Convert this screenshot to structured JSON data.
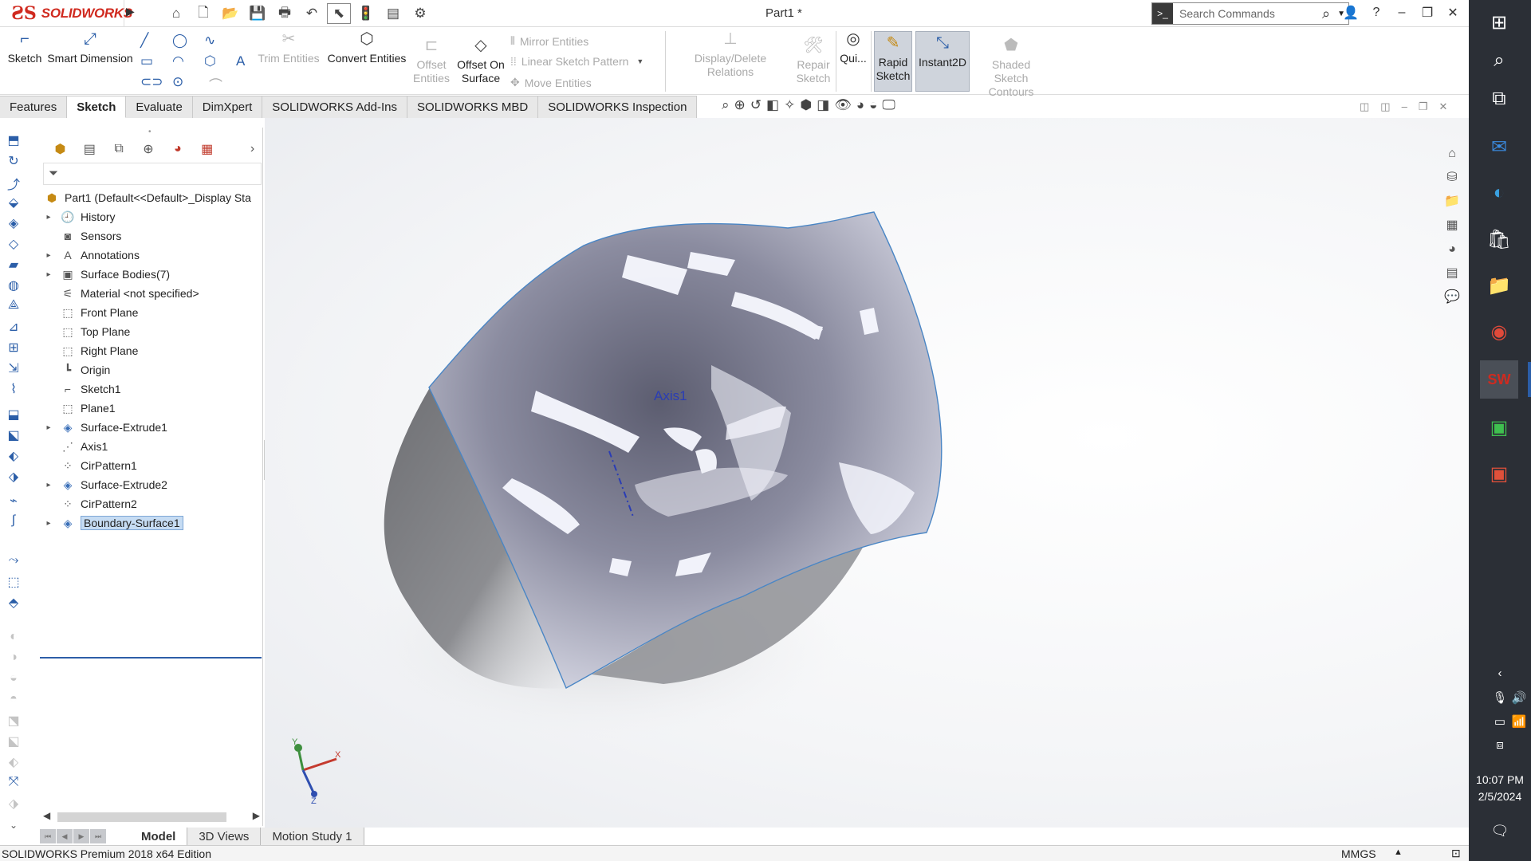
{
  "app": {
    "logo_text": "SOLIDWORKS",
    "doc_title": "Part1 *",
    "search_placeholder": "Search Commands"
  },
  "command_manager": {
    "sketch": "Sketch",
    "smart_dimension_line1": "Smart Dimension",
    "trim_entities": "Trim Entities",
    "convert_entities": "Convert Entities",
    "offset_entities_line1": "Offset",
    "offset_entities_line2": "Entities",
    "offset_on_surface_line1": "Offset On",
    "offset_on_surface_line2": "Surface",
    "mirror_entities": "Mirror Entities",
    "linear_sketch_pattern": "Linear Sketch Pattern",
    "move_entities": "Move Entities",
    "display_delete_relations": "Display/Delete Relations",
    "repair_sketch_line1": "Repair",
    "repair_sketch_line2": "Sketch",
    "quick_snaps": "Qui...",
    "rapid_sketch_line1": "Rapid",
    "rapid_sketch_line2": "Sketch",
    "instant2d": "Instant2D",
    "shaded_sketch_line1": "Shaded Sketch",
    "shaded_sketch_line2": "Contours"
  },
  "tabs": [
    "Features",
    "Sketch",
    "Evaluate",
    "DimXpert",
    "SOLIDWORKS Add-Ins",
    "SOLIDWORKS MBD",
    "SOLIDWORKS Inspection"
  ],
  "active_tab": "Sketch",
  "tree": {
    "root": "Part1  (Default<<Default>_Display Sta",
    "items": [
      {
        "label": "History",
        "icon": "history-icon",
        "expandable": true
      },
      {
        "label": "Sensors",
        "icon": "sensors-icon",
        "expandable": false
      },
      {
        "label": "Annotations",
        "icon": "annotations-icon",
        "expandable": true
      },
      {
        "label": "Surface Bodies(7)",
        "icon": "surface-bodies-icon",
        "expandable": true
      },
      {
        "label": "Material <not specified>",
        "icon": "material-icon",
        "expandable": false
      },
      {
        "label": "Front Plane",
        "icon": "plane-icon",
        "expandable": false
      },
      {
        "label": "Top Plane",
        "icon": "plane-icon",
        "expandable": false
      },
      {
        "label": "Right Plane",
        "icon": "plane-icon",
        "expandable": false
      },
      {
        "label": "Origin",
        "icon": "origin-icon",
        "expandable": false
      },
      {
        "label": "Sketch1",
        "icon": "sketch-icon",
        "expandable": false
      },
      {
        "label": "Plane1",
        "icon": "plane-icon",
        "expandable": false
      },
      {
        "label": "Surface-Extrude1",
        "icon": "surface-extrude-icon",
        "expandable": true
      },
      {
        "label": "Axis1",
        "icon": "axis-icon",
        "expandable": false
      },
      {
        "label": "CirPattern1",
        "icon": "circular-pattern-icon",
        "expandable": false
      },
      {
        "label": "Surface-Extrude2",
        "icon": "surface-extrude-icon",
        "expandable": true
      },
      {
        "label": "CirPattern2",
        "icon": "circular-pattern-icon",
        "expandable": false
      },
      {
        "label": "Boundary-Surface1",
        "icon": "boundary-surface-icon",
        "expandable": true
      }
    ],
    "selected": "Boundary-Surface1"
  },
  "viewport": {
    "axis_label": "Axis1",
    "triad_x": "X",
    "triad_y": "Y",
    "triad_z": "Z"
  },
  "bottom_tabs": [
    "Model",
    "3D Views",
    "Motion Study 1"
  ],
  "active_bottom_tab": "Model",
  "status": {
    "edition": "SOLIDWORKS Premium 2018 x64 Edition",
    "units": "MMGS"
  },
  "taskbar": {
    "time": "10:07 PM",
    "date": "2/5/2024"
  },
  "colors": {
    "brand_red": "#d02a1f",
    "accent_blue": "#2b5ea8",
    "selection": "#c6dcf3",
    "taskbar": "#2b2f36"
  }
}
